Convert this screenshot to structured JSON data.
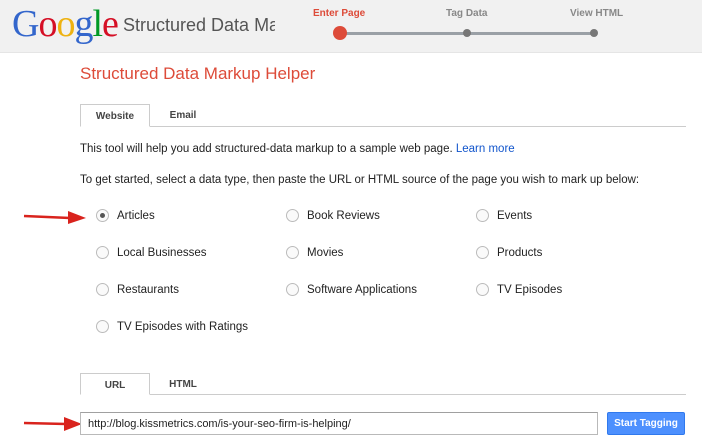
{
  "header": {
    "logo_letters": [
      "G",
      "o",
      "o",
      "g",
      "l",
      "e"
    ],
    "app_title": "Structured Data Ma",
    "steps": [
      {
        "label": "Enter Page",
        "active": true
      },
      {
        "label": "Tag Data",
        "active": false
      },
      {
        "label": "View HTML",
        "active": false
      }
    ]
  },
  "main": {
    "heading": "Structured Data Markup Helper",
    "source_tabs": [
      {
        "label": "Website",
        "active": true
      },
      {
        "label": "Email",
        "active": false
      }
    ],
    "intro_text": "This tool will help you add structured-data markup to a sample web page.",
    "learn_more": "Learn more",
    "instructions": "To get started, select a data type, then paste the URL or HTML source of the page you wish to mark up below:",
    "data_types": [
      {
        "label": "Articles",
        "checked": true
      },
      {
        "label": "Book Reviews",
        "checked": false
      },
      {
        "label": "Events",
        "checked": false
      },
      {
        "label": "Local Businesses",
        "checked": false
      },
      {
        "label": "Movies",
        "checked": false
      },
      {
        "label": "Products",
        "checked": false
      },
      {
        "label": "Restaurants",
        "checked": false
      },
      {
        "label": "Software Applications",
        "checked": false
      },
      {
        "label": "TV Episodes",
        "checked": false
      },
      {
        "label": "TV Episodes with Ratings",
        "checked": false
      }
    ],
    "input_tabs": [
      {
        "label": "URL",
        "active": true
      },
      {
        "label": "HTML",
        "active": false
      }
    ],
    "url_value": "http://blog.kissmetrics.com/is-your-seo-firm-is-helping/",
    "start_button": "Start Tagging"
  },
  "colors": {
    "accent_red": "#dd4b39",
    "link_blue": "#1155cc",
    "button_blue": "#4d90fe",
    "annotation_arrow": "#d9231d"
  }
}
